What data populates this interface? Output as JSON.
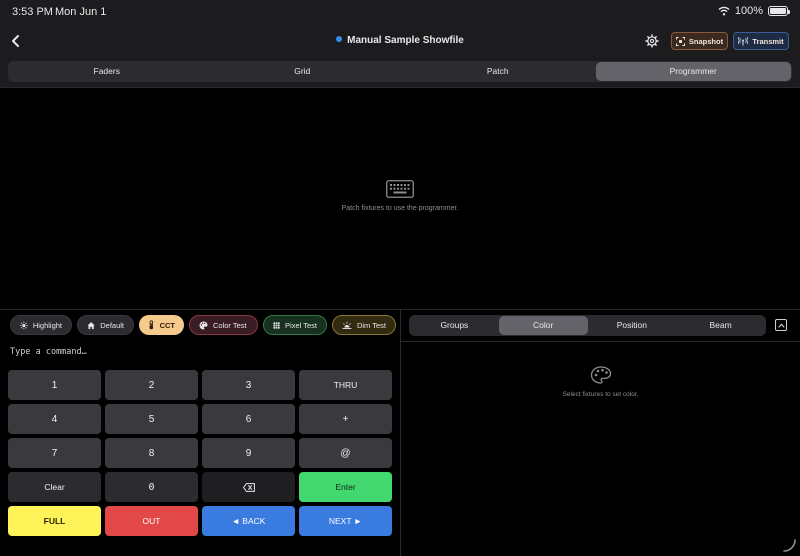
{
  "status": {
    "time": "3:53 PM",
    "date": "Mon Jun 1",
    "battery": "100%"
  },
  "nav": {
    "title": "Manual Sample Showfile",
    "snapshot_label": "Snapshot",
    "transmit_label": "Transmit"
  },
  "tabs": [
    {
      "label": "Faders"
    },
    {
      "label": "Grid"
    },
    {
      "label": "Patch"
    },
    {
      "label": "Programmer",
      "active": true
    }
  ],
  "programmer": {
    "empty_message": "Patch fixtures to use the programmer.",
    "icon": "keyboard-icon"
  },
  "quick_buttons": {
    "highlight": "Highlight",
    "default": "Default",
    "cct": "CCT",
    "color_test": "Color Test",
    "pixel_test": "Pixel Test",
    "dim_test": "Dim Test"
  },
  "command": {
    "placeholder": "Type a command…",
    "value": ""
  },
  "keypad": {
    "k1": "1",
    "k2": "2",
    "k3": "3",
    "thru": "THRU",
    "k4": "4",
    "k5": "5",
    "k6": "6",
    "plus": "+",
    "k7": "7",
    "k8": "8",
    "k9": "9",
    "at": "@",
    "clear": "Clear",
    "k0": "0",
    "enter": "Enter",
    "full": "FULL",
    "out": "OUT",
    "back": "◄ BACK",
    "next": "NEXT ►"
  },
  "side_tabs": [
    {
      "label": "Groups"
    },
    {
      "label": "Color",
      "active": true
    },
    {
      "label": "Position"
    },
    {
      "label": "Beam"
    }
  ],
  "side": {
    "empty_message": "Select fixtures to set color.",
    "icon": "palette-icon"
  },
  "colors": {
    "accent_blue": "#3a7be0",
    "enter_green": "#43d86f",
    "full_yellow": "#fff35a",
    "out_red": "#e24848",
    "cct_amber": "#f6c98c"
  }
}
